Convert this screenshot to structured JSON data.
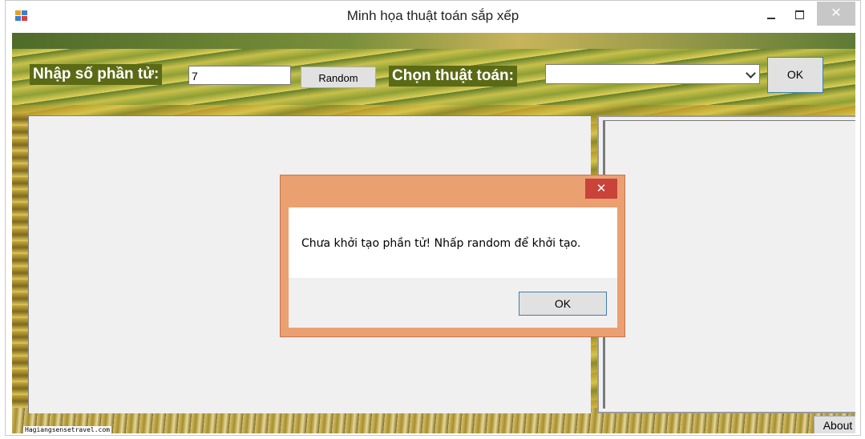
{
  "window": {
    "title": "Minh họa thuật toán sắp xếp",
    "close_glyph": "✕"
  },
  "toolbar": {
    "count_label": "Nhập số phần tử:",
    "count_value": "7",
    "random_label": "Random",
    "algo_label": "Chọn thuật toán:",
    "algo_selected": "",
    "ok_label": "OK"
  },
  "footer": {
    "watermark": "Hagiangsensetravel.com",
    "about_label": "About"
  },
  "dialog": {
    "close_glyph": "✕",
    "message": "Chưa khởi tạo phần tử! Nhấp random để khởi tạo.",
    "ok_label": "OK"
  }
}
